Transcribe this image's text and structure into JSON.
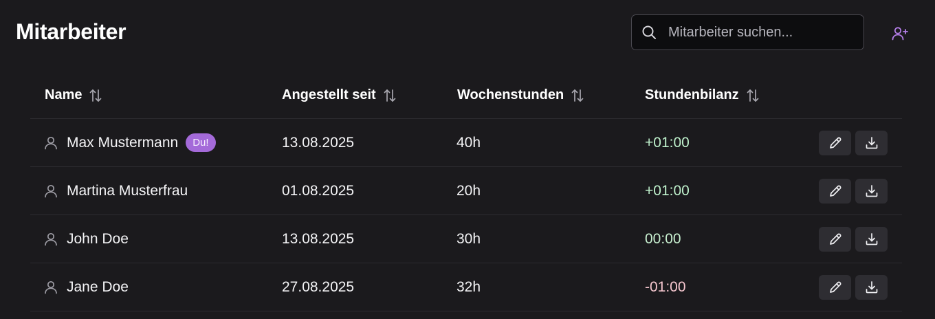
{
  "header": {
    "title": "Mitarbeiter",
    "search_placeholder": "Mitarbeiter suchen..."
  },
  "table": {
    "columns": [
      "Name",
      "Angestellt seit",
      "Wochenstunden",
      "Stundenbilanz"
    ],
    "rows": [
      {
        "name": "Max Mustermann",
        "badge": "Du!",
        "since": "13.08.2025",
        "hours": "40h",
        "balance": "+01:00"
      },
      {
        "name": "Martina Musterfrau",
        "since": "01.08.2025",
        "hours": "20h",
        "balance": "+01:00"
      },
      {
        "name": "John Doe",
        "since": "13.08.2025",
        "hours": "30h",
        "balance": "00:00"
      },
      {
        "name": "Jane Doe",
        "since": "27.08.2025",
        "hours": "32h",
        "balance": "-01:00"
      }
    ]
  },
  "icons": {
    "search": "search-icon",
    "add_user": "user-plus-icon",
    "user": "user-icon",
    "sort": "sort-arrows-icon",
    "edit": "pencil-icon",
    "download": "download-icon"
  },
  "colors": {
    "accent": "#a46ad9",
    "balance_positive": "#bff1cc",
    "balance_zero": "#c8f0d0",
    "balance_negative": "#f6c7cf"
  }
}
